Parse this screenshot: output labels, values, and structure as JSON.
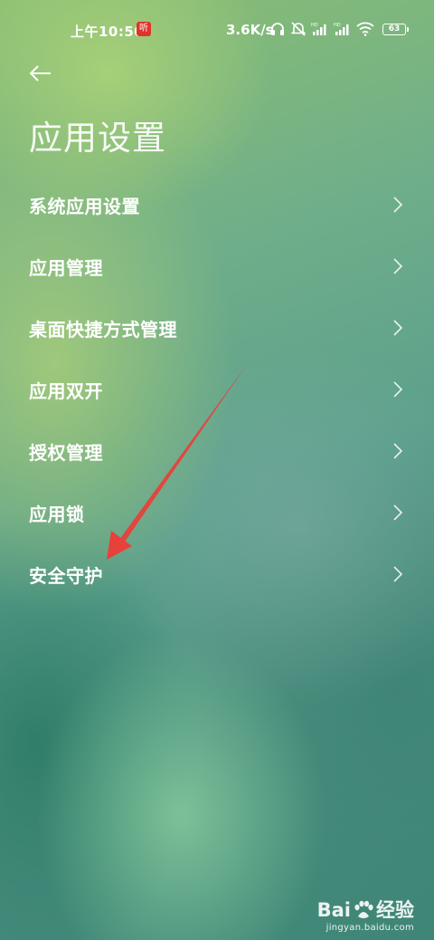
{
  "status_bar": {
    "time": "上午10:50",
    "app_badge": "听",
    "net_speed": "3.6K/s",
    "battery": "63",
    "icons": [
      "headset-icon",
      "mute-icon",
      "hd-signal-icon",
      "hd-signal-icon",
      "wifi-icon",
      "battery-icon"
    ]
  },
  "header": {
    "back_icon": "arrow-left-icon",
    "title": "应用设置"
  },
  "menu": {
    "items": [
      {
        "label": "系统应用设置"
      },
      {
        "label": "应用管理"
      },
      {
        "label": "桌面快捷方式管理"
      },
      {
        "label": "应用双开"
      },
      {
        "label": "授权管理"
      },
      {
        "label": "应用锁"
      },
      {
        "label": "安全守护"
      }
    ]
  },
  "annotation": {
    "color": "#e8403a"
  },
  "watermark": {
    "brand_left": "Bai",
    "brand_right": "经验",
    "url": "jingyan.baidu.com"
  }
}
